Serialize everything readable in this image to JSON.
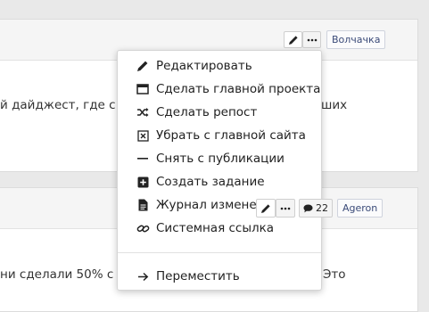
{
  "card1": {
    "body_left": "й дайджест, где с",
    "body_right": "ших",
    "edit_icon": "pencil-icon",
    "more_icon": "ellipsis-icon",
    "author": "Волчачка"
  },
  "card2": {
    "body_left": "ни сделали 50% с",
    "body_right": "Это",
    "edit_icon": "pencil-icon",
    "more_icon": "ellipsis-icon",
    "comment_icon": "speech-bubble-icon",
    "comments_count": "22",
    "author": "Ageron"
  },
  "menu": {
    "items": [
      {
        "label": "Редактировать",
        "icon": "pencil-icon"
      },
      {
        "label": "Сделать главной проекта",
        "icon": "window-icon"
      },
      {
        "label": "Сделать репост",
        "icon": "shuffle-icon"
      },
      {
        "label": "Убрать с главной сайта",
        "icon": "x-box-icon"
      },
      {
        "label": "Снять с публикации",
        "icon": "dash-icon"
      },
      {
        "label": "Создать задание",
        "icon": "plus-box-icon"
      },
      {
        "label": "Журнал изменени",
        "icon": "document-icon"
      },
      {
        "label": "Системная ссылка",
        "icon": "link-icon"
      },
      {
        "label": "Переместить",
        "icon": "arrow-right-icon"
      }
    ]
  }
}
